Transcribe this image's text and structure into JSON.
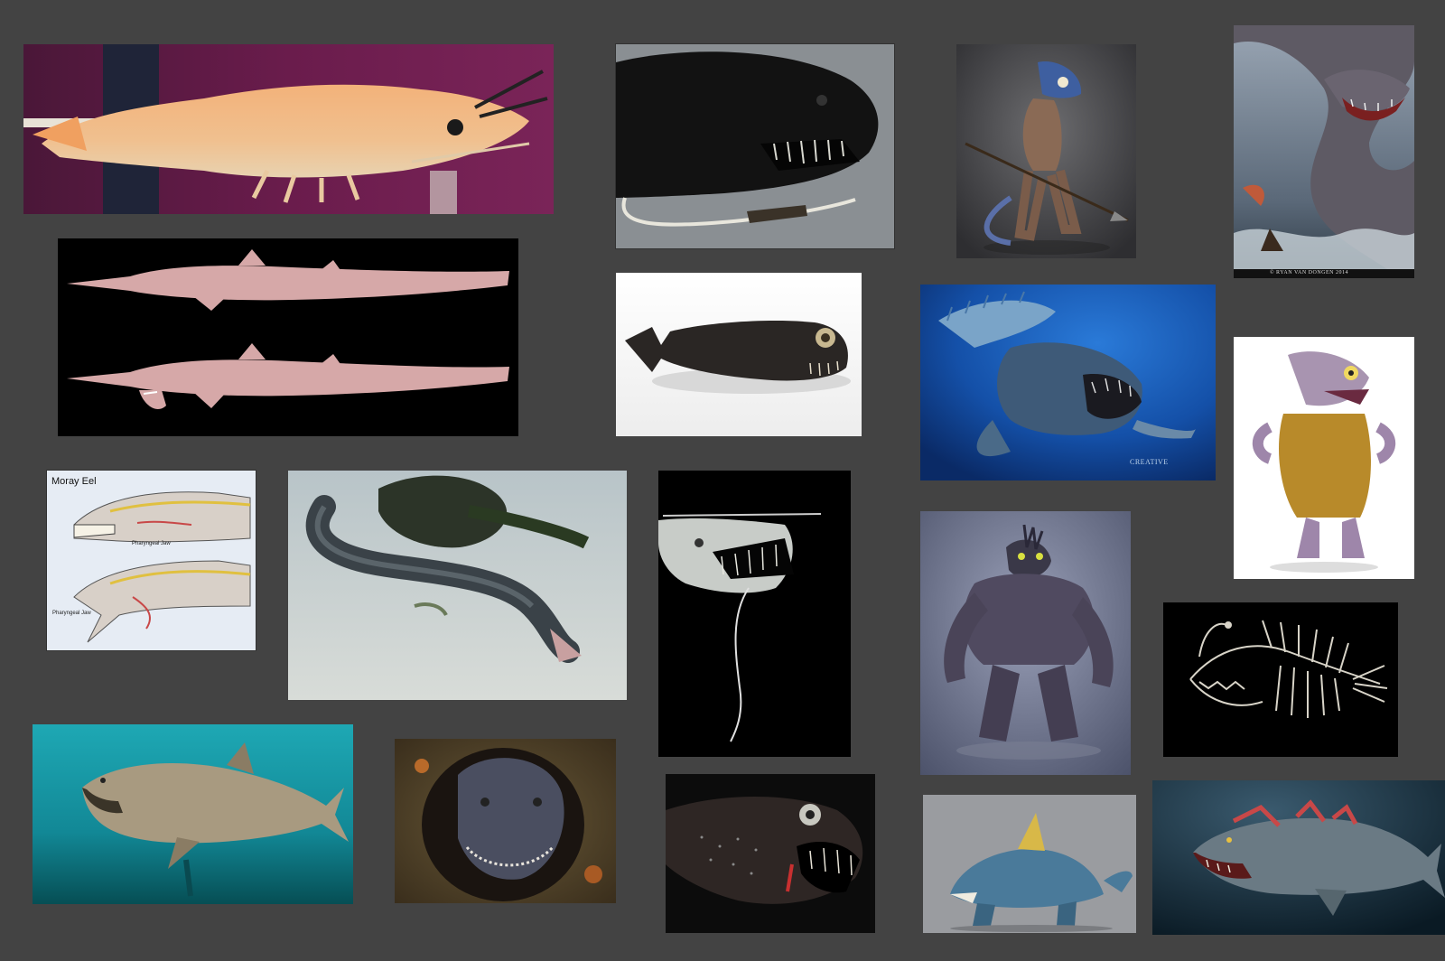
{
  "board": {
    "background": "#434343"
  },
  "tiles": [
    {
      "id": "shrimp",
      "icon": "shrimp-photo"
    },
    {
      "id": "dragonfish-barbel",
      "icon": "dragonfish-photo"
    },
    {
      "id": "fishman-spear",
      "icon": "fishman-art"
    },
    {
      "id": "sea-serpent",
      "icon": "sea-serpent-art"
    },
    {
      "id": "goblin-shark",
      "icon": "goblin-shark-photo"
    },
    {
      "id": "dragonfish-specimen",
      "icon": "dragonfish-photo"
    },
    {
      "id": "dunkleosteus",
      "icon": "dunkleosteus-art"
    },
    {
      "id": "fishman-tunic",
      "icon": "fishman-art"
    },
    {
      "id": "moray-eel-diagram",
      "icon": "anatomy-diagram"
    },
    {
      "id": "eel-on-sand",
      "icon": "eel-photo"
    },
    {
      "id": "viperfish",
      "icon": "viperfish-photo"
    },
    {
      "id": "fish-brute",
      "icon": "creature-art"
    },
    {
      "id": "anglerfish-skeleton",
      "icon": "skeleton-photo"
    },
    {
      "id": "megamouth-shark",
      "icon": "shark-photo"
    },
    {
      "id": "conger-eel",
      "icon": "eel-photo"
    },
    {
      "id": "dragonfish-dark",
      "icon": "dragonfish-photo"
    },
    {
      "id": "shark-beast",
      "icon": "creature-art"
    },
    {
      "id": "shark-concept",
      "icon": "shark-art"
    }
  ],
  "moray": {
    "title": "Moray Eel",
    "label_top": "Pharyngeal Jaw",
    "label_bottom": "Pharyngeal Jaw"
  },
  "credits": {
    "serpent": "© RYAN VAN DONGEN 2014",
    "dunkle": "CREATIVE"
  }
}
